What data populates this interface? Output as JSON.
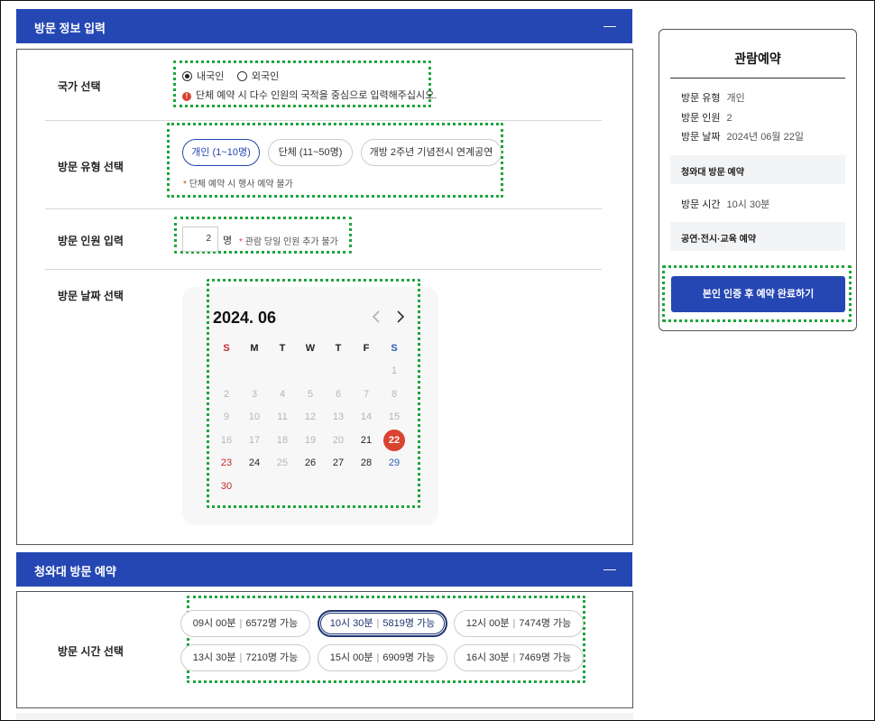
{
  "visit_info": {
    "header": "방문 정보 입력",
    "collapse_icon": "minus-icon",
    "nationality": {
      "label": "국가 선택",
      "options": [
        "내국인",
        "외국인"
      ],
      "selected": "내국인",
      "warning": "단체 예약 시 다수 인원의 국적을 중심으로 입력해주십시오."
    },
    "visit_type": {
      "label": "방문 유형 선택",
      "options": [
        "개인 (1~10명)",
        "단체 (11~50명)",
        "개방 2주년 기념전시 연계공연"
      ],
      "selected": "개인 (1~10명)",
      "note": "단체 예약 시 행사 예약 불가"
    },
    "headcount": {
      "label": "방문 인원 입력",
      "value": "2",
      "unit": "명",
      "note": "관람 당일 인원 추가 불가"
    },
    "date": {
      "label": "방문 날짜 선택",
      "month_title": "2024. 06",
      "weekdays": [
        "S",
        "M",
        "T",
        "W",
        "T",
        "F",
        "S"
      ],
      "days": [
        [
          "",
          "",
          "",
          "",
          "",
          "",
          "1"
        ],
        [
          "2",
          "3",
          "4",
          "5",
          "6",
          "7",
          "8"
        ],
        [
          "9",
          "10",
          "11",
          "12",
          "13",
          "14",
          "15"
        ],
        [
          "16",
          "17",
          "18",
          "19",
          "20",
          "21",
          "22"
        ],
        [
          "23",
          "24",
          "25",
          "26",
          "27",
          "28",
          "29"
        ],
        [
          "30",
          "",
          "",
          "",
          "",
          "",
          ""
        ]
      ],
      "available": [
        "21",
        "22",
        "23",
        "24",
        "26",
        "27",
        "28",
        "29",
        "30"
      ],
      "selected_day": "22",
      "prev_icon": "chevron-left-icon",
      "next_icon": "chevron-right-icon"
    }
  },
  "cheongwadae": {
    "header": "청와대 방문 예약",
    "time_label": "방문 시간 선택",
    "slots": [
      {
        "time": "09시 00분",
        "cap": "6572명 가능"
      },
      {
        "time": "10시 30분",
        "cap": "5819명 가능"
      },
      {
        "time": "12시 00분",
        "cap": "7474명 가능"
      },
      {
        "time": "13시 30분",
        "cap": "7210명 가능"
      },
      {
        "time": "15시 00분",
        "cap": "6909명 가능"
      },
      {
        "time": "16시 30분",
        "cap": "7469명 가능"
      }
    ],
    "selected_slot": "10시 30분"
  },
  "summary": {
    "title": "관람예약",
    "rows": [
      {
        "k": "방문 유형",
        "v": "개인"
      },
      {
        "k": "방문 인원",
        "v": "2"
      },
      {
        "k": "방문 날짜",
        "v": "2024년 06월 22일"
      }
    ],
    "section1": "청와대 방문 예약",
    "time_k": "방문 시간",
    "time_v": "10시 30분",
    "section2": "공연·전시·교육 예약",
    "cta": "본인 인증 후 예약 완료하기"
  },
  "colors": {
    "primary": "#2547b3",
    "selected_day": "#d9432f",
    "highlight": "#1ea53c"
  }
}
